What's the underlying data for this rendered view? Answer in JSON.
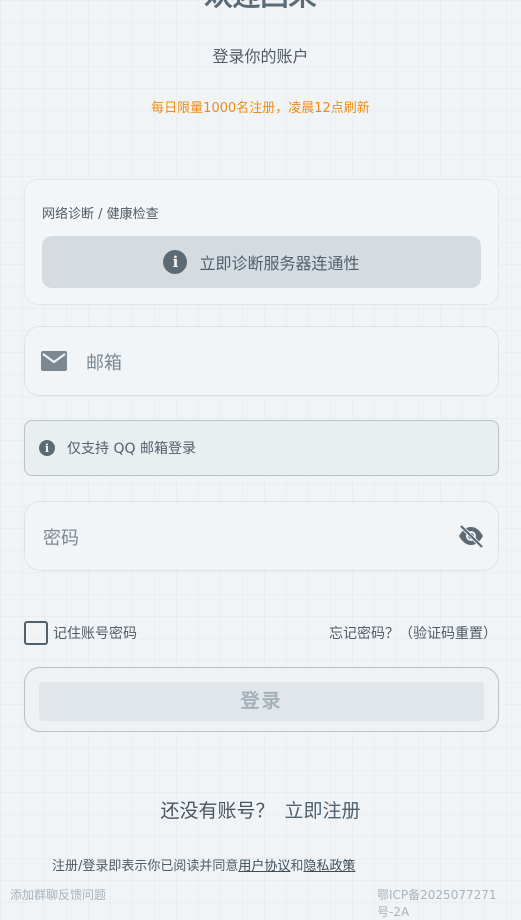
{
  "header": {
    "title": "欢迎回来",
    "subtitle": "登录你的账户",
    "notice": "每日限量1000名注册，凌晨12点刷新"
  },
  "diagnosis": {
    "label": "网络诊断 / 健康检查",
    "button_label": "立即诊断服务器连通性"
  },
  "form": {
    "email_placeholder": "邮箱",
    "qq_tip": "仅支持 QQ 邮箱登录",
    "password_placeholder": "密码",
    "remember_label": "记住账号密码",
    "forgot_label": "忘记密码？（验证码重置）",
    "login_label": "登录"
  },
  "signup": {
    "prompt": "还没有账号？",
    "link": "立即注册"
  },
  "agreement": {
    "prefix": "注册/登录即表示你已阅读并同意",
    "user_agreement": "用户协议",
    "and": "和",
    "privacy_policy": "隐私政策"
  },
  "footer": {
    "feedback": "添加群聊反馈问题",
    "icp": "鄂ICP备2025077271号-2A"
  },
  "icons": {
    "info": "info-icon",
    "mail": "mail-icon",
    "eye_off": "eye-off-icon"
  },
  "colors": {
    "accent_notice": "#f08c12",
    "button_bg": "#d4dce2"
  }
}
